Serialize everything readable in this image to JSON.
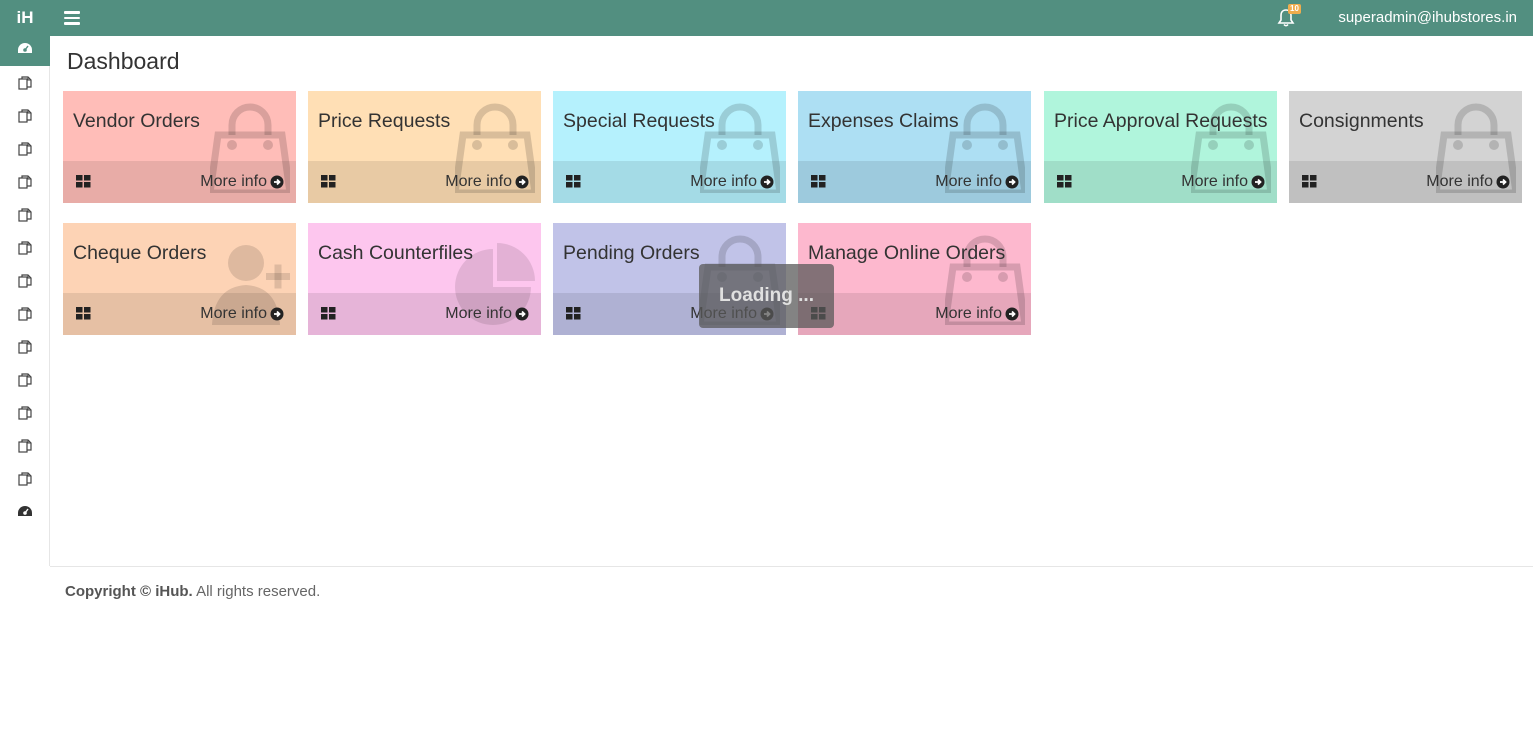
{
  "app": {
    "logo": "iH",
    "user_email": "superadmin@ihubstores.in",
    "notification_count": "10"
  },
  "sidebar": {
    "items": [
      {
        "icon": "dashboard-icon",
        "active": true
      },
      {
        "icon": "copy-icon"
      },
      {
        "icon": "copy-icon"
      },
      {
        "icon": "copy-icon"
      },
      {
        "icon": "copy-icon"
      },
      {
        "icon": "copy-icon"
      },
      {
        "icon": "copy-icon"
      },
      {
        "icon": "copy-icon"
      },
      {
        "icon": "copy-icon"
      },
      {
        "icon": "copy-icon"
      },
      {
        "icon": "copy-icon"
      },
      {
        "icon": "copy-icon"
      },
      {
        "icon": "copy-icon"
      },
      {
        "icon": "copy-icon"
      },
      {
        "icon": "dashboard-icon"
      }
    ]
  },
  "page": {
    "title": "Dashboard"
  },
  "boxes": [
    {
      "title": "Vendor Orders",
      "more": "More info",
      "color": "#ffbdb8",
      "icon": "shopping-bag-icon"
    },
    {
      "title": "Price Requests",
      "more": "More info",
      "color": "#ffdfb5",
      "icon": "shopping-bag-icon"
    },
    {
      "title": "Special Requests",
      "more": "More info",
      "color": "#b5f1fd",
      "icon": "shopping-bag-icon"
    },
    {
      "title": "Expenses Claims",
      "more": "More info",
      "color": "#addff3",
      "icon": "shopping-bag-icon"
    },
    {
      "title": "Price Approval Requests",
      "more": "More info",
      "color": "#b0f5dc",
      "icon": "shopping-bag-icon"
    },
    {
      "title": "Consignments",
      "more": "More info",
      "color": "#d3d3d3",
      "icon": "shopping-bag-icon"
    },
    {
      "title": "Cheque Orders",
      "more": "More info",
      "color": "#fdd3b5",
      "icon": "user-plus-icon"
    },
    {
      "title": "Cash Counterfiles",
      "more": "More info",
      "color": "#fdc6ee",
      "icon": "pie-chart-icon"
    },
    {
      "title": "Pending Orders",
      "more": "More info",
      "color": "#c1c3e8",
      "icon": "shopping-bag-icon"
    },
    {
      "title": "Manage Online Orders",
      "more": "More info",
      "color": "#fdb8ce",
      "icon": "shopping-bag-icon"
    }
  ],
  "loading": {
    "text": "Loading ..."
  },
  "footer": {
    "copyright_label": "Copyright ©",
    "brand": "iHub.",
    "rights": "All rights reserved."
  }
}
